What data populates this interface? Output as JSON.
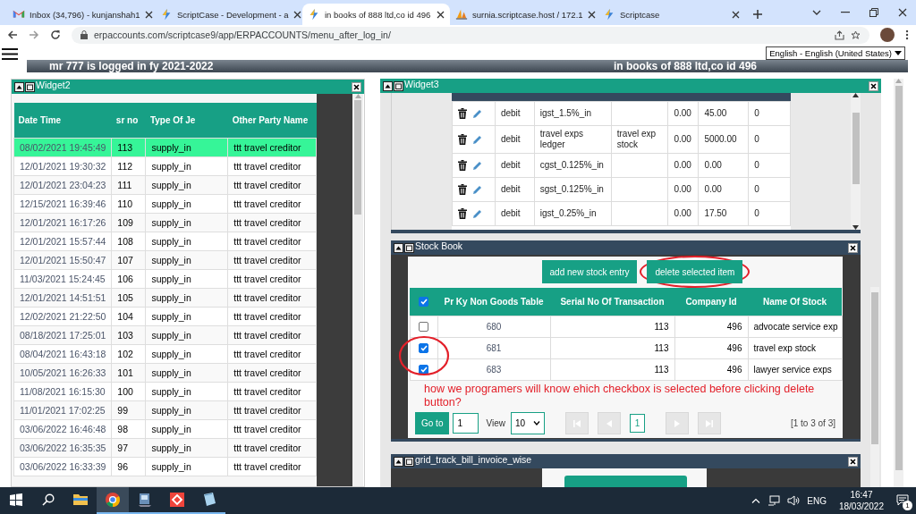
{
  "browser": {
    "tabs": [
      {
        "kind": "mail",
        "title": "Inbox (34,796) - kunjanshah1",
        "selected": false
      },
      {
        "kind": "bolt",
        "title": "ScriptCase - Development - a",
        "selected": false
      },
      {
        "kind": "bolt",
        "title": "in books of 888 ltd,co id 496",
        "selected": true
      },
      {
        "kind": "sail",
        "title": "surnia.scriptcase.host / 172.1",
        "selected": false
      },
      {
        "kind": "bolt",
        "title": "Scriptcase",
        "selected": false
      }
    ],
    "address": "erpaccounts.com/scriptcase9/app/ERPACCOUNTS/menu_after_log_in/"
  },
  "header": {
    "login_text": "mr 777 is logged in fy 2021-2022",
    "company_text": "in books of 888 ltd,co id 496",
    "language": "English - English (United States)"
  },
  "widget2": {
    "title": "Widget2",
    "columns": [
      "Date Time",
      "sr no",
      "Type Of Je",
      "Other Party Name"
    ],
    "rows": [
      {
        "selected": true,
        "cells": [
          "08/02/2021 19:45:49",
          "113",
          "supply_in",
          "ttt travel creditor"
        ]
      },
      {
        "selected": false,
        "cells": [
          "12/01/2021 19:30:32",
          "112",
          "supply_in",
          "ttt travel creditor"
        ]
      },
      {
        "selected": false,
        "cells": [
          "12/01/2021 23:04:23",
          "111",
          "supply_in",
          "ttt travel creditor"
        ]
      },
      {
        "selected": false,
        "cells": [
          "12/15/2021 16:39:46",
          "110",
          "supply_in",
          "ttt travel creditor"
        ]
      },
      {
        "selected": false,
        "cells": [
          "12/01/2021 16:17:26",
          "109",
          "supply_in",
          "ttt travel creditor"
        ]
      },
      {
        "selected": false,
        "cells": [
          "12/01/2021 15:57:44",
          "108",
          "supply_in",
          "ttt travel creditor"
        ]
      },
      {
        "selected": false,
        "cells": [
          "12/01/2021 15:50:47",
          "107",
          "supply_in",
          "ttt travel creditor"
        ]
      },
      {
        "selected": false,
        "cells": [
          "11/03/2021 15:24:45",
          "106",
          "supply_in",
          "ttt travel creditor"
        ]
      },
      {
        "selected": false,
        "cells": [
          "12/01/2021 14:51:51",
          "105",
          "supply_in",
          "ttt travel creditor"
        ]
      },
      {
        "selected": false,
        "cells": [
          "12/02/2021 21:22:50",
          "104",
          "supply_in",
          "ttt travel creditor"
        ]
      },
      {
        "selected": false,
        "cells": [
          "08/18/2021 17:25:01",
          "103",
          "supply_in",
          "ttt travel creditor"
        ]
      },
      {
        "selected": false,
        "cells": [
          "08/04/2021 16:43:18",
          "102",
          "supply_in",
          "ttt travel creditor"
        ]
      },
      {
        "selected": false,
        "cells": [
          "10/05/2021 16:26:33",
          "101",
          "supply_in",
          "ttt travel creditor"
        ]
      },
      {
        "selected": false,
        "cells": [
          "11/08/2021 16:15:30",
          "100",
          "supply_in",
          "ttt travel creditor"
        ]
      },
      {
        "selected": false,
        "cells": [
          "11/01/2021 17:02:25",
          "99",
          "supply_in",
          "ttt travel creditor"
        ]
      },
      {
        "selected": false,
        "cells": [
          "03/06/2022 16:46:48",
          "98",
          "supply_in",
          "ttt travel creditor"
        ]
      },
      {
        "selected": false,
        "cells": [
          "03/06/2022 16:35:35",
          "97",
          "supply_in",
          "ttt travel creditor"
        ]
      },
      {
        "selected": false,
        "cells": [
          "03/06/2022 16:33:39",
          "96",
          "supply_in",
          "ttt travel creditor"
        ]
      }
    ]
  },
  "widget3": {
    "title": "Widget3",
    "rows": [
      {
        "entry_type": "debit",
        "ledger": "igst_1.5%_in",
        "column_4": "0.00",
        "column_5": "45.00",
        "column_6": "0"
      },
      {
        "entry_type": "debit",
        "ledger": "travel exps ledger",
        "stock": "travel exp stock",
        "column_4": "0.00",
        "column_5": "5000.00",
        "column_6": "0"
      },
      {
        "entry_type": "debit",
        "ledger": "cgst_0.125%_in",
        "column_4": "0.00",
        "column_5": "0.00",
        "column_6": "0"
      },
      {
        "entry_type": "debit",
        "ledger": "sgst_0.125%_in",
        "column_4": "0.00",
        "column_5": "0.00",
        "column_6": "0"
      },
      {
        "entry_type": "debit",
        "ledger": "igst_0.25%_in",
        "column_4": "0.00",
        "column_5": "17.50",
        "column_6": "0"
      }
    ]
  },
  "stock_book": {
    "title": "Stock Book",
    "buttons": [
      {
        "label": "add new stock entry",
        "highlighted": false
      },
      {
        "label": "delete selected item",
        "highlighted": true
      }
    ],
    "select_all_checked": true,
    "columns": [
      "Pr Ky Non Goods Table",
      "Serial No Of Transaction",
      "Company Id",
      "Name Of Stock"
    ],
    "rows": [
      {
        "checked": false,
        "cells": [
          "680",
          "113",
          "496",
          "advocate service exp"
        ]
      },
      {
        "checked": true,
        "cells": [
          "681",
          "113",
          "496",
          "travel exp stock"
        ]
      },
      {
        "checked": true,
        "cells": [
          "683",
          "113",
          "496",
          "lawyer service exps"
        ]
      }
    ],
    "goto_label": "Go to",
    "goto_value": "1",
    "view_label": "View",
    "view_value": "10",
    "nav_buttons": [
      {
        "kind": "first",
        "disabled": true
      },
      {
        "kind": "prev",
        "disabled": true
      },
      {
        "kind": "page",
        "label": "1",
        "disabled": false
      },
      {
        "kind": "next",
        "disabled": true
      },
      {
        "kind": "last",
        "disabled": true
      }
    ],
    "range": "[1 to 3 of 3]",
    "annotation": "how we programers will know ehich checkbox is selected before clicking delete button?"
  },
  "widget4": {
    "title": "grid_track_bill_invoice_wise"
  },
  "taskbar": {
    "apps": [
      {
        "kind": "folder",
        "active": false,
        "running": false
      },
      {
        "kind": "chrome",
        "active": true,
        "running": true
      },
      {
        "kind": "installer",
        "active": false,
        "running": true
      },
      {
        "kind": "remote",
        "active": false,
        "running": true
      },
      {
        "kind": "notepad",
        "active": false,
        "running": true
      }
    ],
    "language": "ENG",
    "time": "16:47",
    "date": "18/03/2022",
    "notification_count": "1"
  }
}
